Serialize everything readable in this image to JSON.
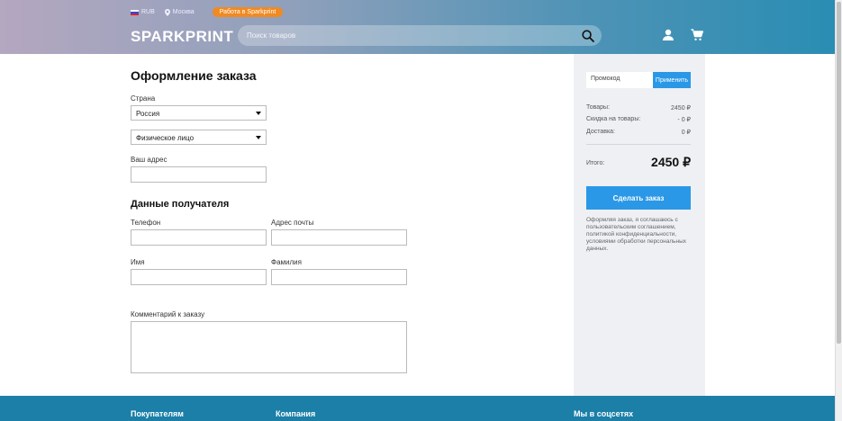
{
  "header": {
    "currency": "RUB",
    "city": "Москва",
    "job_link": "Работа в Sparkprint",
    "logo": "SPARKPRINT",
    "search_placeholder": "Поиск товаров"
  },
  "main": {
    "title": "Оформление заказа",
    "country_label": "Страна",
    "country_value": "Россия",
    "person_type_value": "Физическое лицо",
    "address_label": "Ваш адрес",
    "recipient_title": "Данные получателя",
    "phone_label": "Телефон",
    "email_label": "Адрес почты",
    "first_name_label": "Имя",
    "last_name_label": "Фамилия",
    "comment_label": "Комментарий к заказу"
  },
  "summary": {
    "promo_placeholder": "Промокод",
    "apply_label": "Применить",
    "goods_label": "Товары:",
    "goods_value": "2450 ₽",
    "discount_label": "Скидка на товары:",
    "discount_value": "- 0 ₽",
    "delivery_label": "Доставка:",
    "delivery_value": "0 ₽",
    "total_label": "Итого:",
    "total_value": "2450 ₽",
    "order_button": "Сделать заказ",
    "legal_text": "Оформляя заказ, я соглашаюсь с пользовательским соглашением, политикой конфиденциальности, условиями обработки персональных данных."
  },
  "footer": {
    "col1": "Покупателям",
    "col2": "Компания",
    "col3": "Мы в соцсетях"
  },
  "colors": {
    "accent": "#2a98e6",
    "job_badge": "#f08a22",
    "footer": "#1b7fa8",
    "sidebar_bg": "#eef0f4"
  }
}
